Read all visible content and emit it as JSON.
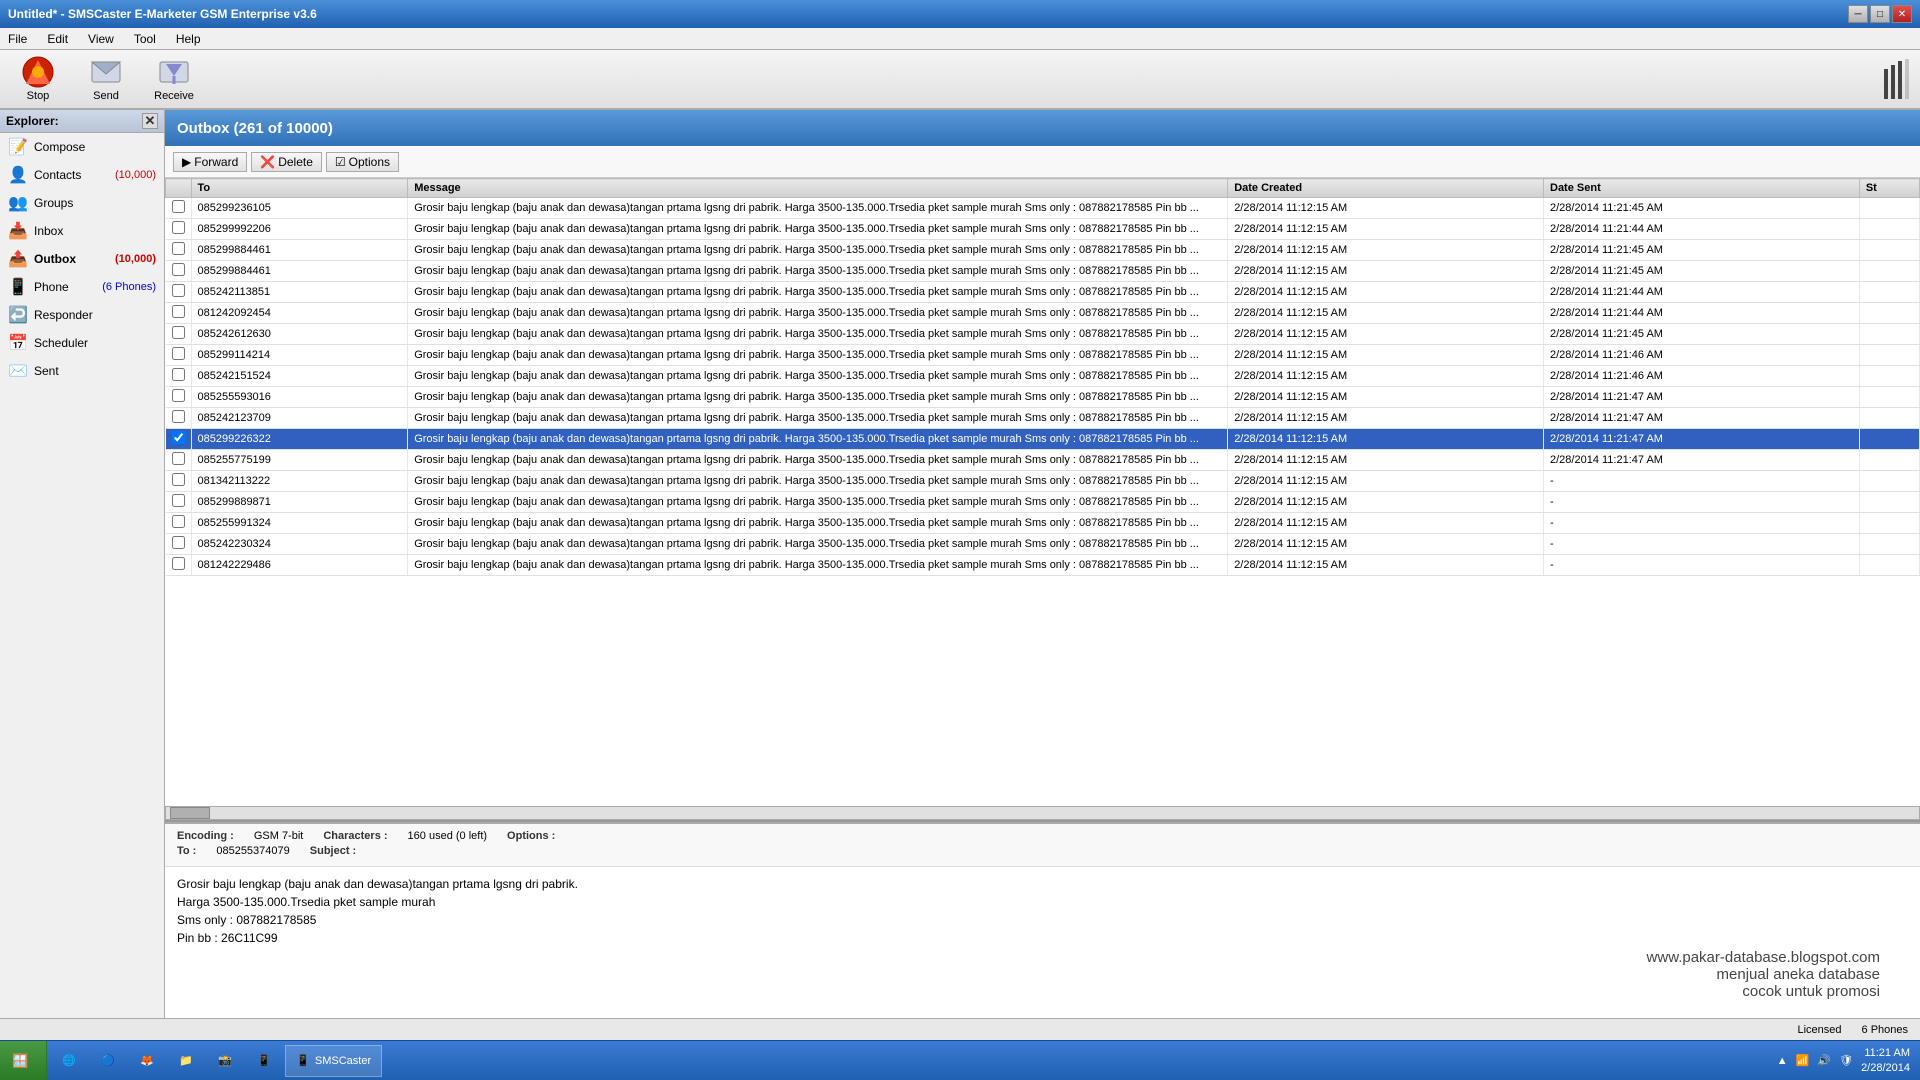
{
  "window": {
    "title": "Untitled* - SMSCaster E-Marketer GSM Enterprise v3.6",
    "controls": [
      "minimize",
      "maximize",
      "close"
    ]
  },
  "menu": {
    "items": [
      "File",
      "Edit",
      "View",
      "Tool",
      "Help"
    ]
  },
  "toolbar": {
    "stop_label": "Stop",
    "send_label": "Send",
    "receive_label": "Receive"
  },
  "explorer": {
    "title": "Explorer:",
    "items": [
      {
        "id": "compose",
        "label": "Compose",
        "badge": ""
      },
      {
        "id": "contacts",
        "label": "Contacts",
        "badge": "(10,000)"
      },
      {
        "id": "groups",
        "label": "Groups",
        "badge": ""
      },
      {
        "id": "inbox",
        "label": "Inbox",
        "badge": ""
      },
      {
        "id": "outbox",
        "label": "Outbox",
        "badge": "(10,000)"
      },
      {
        "id": "phone",
        "label": "Phone",
        "badge": "(6 Phones)"
      },
      {
        "id": "responder",
        "label": "Responder",
        "badge": ""
      },
      {
        "id": "scheduler",
        "label": "Scheduler",
        "badge": ""
      },
      {
        "id": "sent",
        "label": "Sent",
        "badge": ""
      }
    ]
  },
  "outbox": {
    "title": "Outbox (261 of 10000)"
  },
  "actions": {
    "forward": "Forward",
    "delete": "Delete",
    "options": "Options"
  },
  "table": {
    "columns": [
      "",
      "To",
      "Message",
      "Date Created",
      "Date Sent",
      "St"
    ],
    "rows": [
      {
        "to": "085299236105",
        "message": "Grosir baju lengkap (baju anak dan dewasa)tangan prtama lgsng dri pabrik. Harga 3500-135.000.Trsedia pket sample murah Sms only : 087882178585 Pin bb ...",
        "date_created": "2/28/2014 11:12:15 AM",
        "date_sent": "2/28/2014 11:21:45 AM",
        "selected": false
      },
      {
        "to": "085299992206",
        "message": "Grosir baju lengkap (baju anak dan dewasa)tangan prtama lgsng dri pabrik. Harga 3500-135.000.Trsedia pket sample murah Sms only : 087882178585 Pin bb ...",
        "date_created": "2/28/2014 11:12:15 AM",
        "date_sent": "2/28/2014 11:21:44 AM",
        "selected": false
      },
      {
        "to": "085299884461",
        "message": "Grosir baju lengkap (baju anak dan dewasa)tangan prtama lgsng dri pabrik. Harga 3500-135.000.Trsedia pket sample murah Sms only : 087882178585 Pin bb ...",
        "date_created": "2/28/2014 11:12:15 AM",
        "date_sent": "2/28/2014 11:21:45 AM",
        "selected": false
      },
      {
        "to": "085299884461",
        "message": "Grosir baju lengkap (baju anak dan dewasa)tangan prtama lgsng dri pabrik. Harga 3500-135.000.Trsedia pket sample murah Sms only : 087882178585 Pin bb ...",
        "date_created": "2/28/2014 11:12:15 AM",
        "date_sent": "2/28/2014 11:21:45 AM",
        "selected": false
      },
      {
        "to": "085242113851",
        "message": "Grosir baju lengkap (baju anak dan dewasa)tangan prtama lgsng dri pabrik. Harga 3500-135.000.Trsedia pket sample murah Sms only : 087882178585 Pin bb ...",
        "date_created": "2/28/2014 11:12:15 AM",
        "date_sent": "2/28/2014 11:21:44 AM",
        "selected": false
      },
      {
        "to": "081242092454",
        "message": "Grosir baju lengkap (baju anak dan dewasa)tangan prtama lgsng dri pabrik. Harga 3500-135.000.Trsedia pket sample murah Sms only : 087882178585 Pin bb ...",
        "date_created": "2/28/2014 11:12:15 AM",
        "date_sent": "2/28/2014 11:21:44 AM",
        "selected": false
      },
      {
        "to": "085242612630",
        "message": "Grosir baju lengkap (baju anak dan dewasa)tangan prtama lgsng dri pabrik. Harga 3500-135.000.Trsedia pket sample murah Sms only : 087882178585 Pin bb ...",
        "date_created": "2/28/2014 11:12:15 AM",
        "date_sent": "2/28/2014 11:21:45 AM",
        "selected": false
      },
      {
        "to": "085299114214",
        "message": "Grosir baju lengkap (baju anak dan dewasa)tangan prtama lgsng dri pabrik. Harga 3500-135.000.Trsedia pket sample murah Sms only : 087882178585 Pin bb ...",
        "date_created": "2/28/2014 11:12:15 AM",
        "date_sent": "2/28/2014 11:21:46 AM",
        "selected": false
      },
      {
        "to": "085242151524",
        "message": "Grosir baju lengkap (baju anak dan dewasa)tangan prtama lgsng dri pabrik. Harga 3500-135.000.Trsedia pket sample murah Sms only : 087882178585 Pin bb ...",
        "date_created": "2/28/2014 11:12:15 AM",
        "date_sent": "2/28/2014 11:21:46 AM",
        "selected": false
      },
      {
        "to": "085255593016",
        "message": "Grosir baju lengkap (baju anak dan dewasa)tangan prtama lgsng dri pabrik. Harga 3500-135.000.Trsedia pket sample murah Sms only : 087882178585 Pin bb ...",
        "date_created": "2/28/2014 11:12:15 AM",
        "date_sent": "2/28/2014 11:21:47 AM",
        "selected": false
      },
      {
        "to": "085242123709",
        "message": "Grosir baju lengkap (baju anak dan dewasa)tangan prtama lgsng dri pabrik. Harga 3500-135.000.Trsedia pket sample murah Sms only : 087882178585 Pin bb ...",
        "date_created": "2/28/2014 11:12:15 AM",
        "date_sent": "2/28/2014 11:21:47 AM",
        "selected": false
      },
      {
        "to": "085299226322",
        "message": "Grosir baju lengkap (baju anak dan dewasa)tangan prtama lgsng dri pabrik. Harga 3500-135.000.Trsedia pket sample murah Sms only : 087882178585 Pin bb ...",
        "date_created": "2/28/2014 11:12:15 AM",
        "date_sent": "2/28/2014 11:21:47 AM",
        "selected": true
      },
      {
        "to": "085255775199",
        "message": "Grosir baju lengkap (baju anak dan dewasa)tangan prtama lgsng dri pabrik. Harga 3500-135.000.Trsedia pket sample murah Sms only : 087882178585 Pin bb ...",
        "date_created": "2/28/2014 11:12:15 AM",
        "date_sent": "2/28/2014 11:21:47 AM",
        "selected": false
      },
      {
        "to": "081342113222",
        "message": "Grosir baju lengkap (baju anak dan dewasa)tangan prtama lgsng dri pabrik. Harga 3500-135.000.Trsedia pket sample murah Sms only : 087882178585 Pin bb ...",
        "date_created": "2/28/2014 11:12:15 AM",
        "date_sent": "-",
        "selected": false
      },
      {
        "to": "085299889871",
        "message": "Grosir baju lengkap (baju anak dan dewasa)tangan prtama lgsng dri pabrik. Harga 3500-135.000.Trsedia pket sample murah Sms only : 087882178585 Pin bb ...",
        "date_created": "2/28/2014 11:12:15 AM",
        "date_sent": "-",
        "selected": false
      },
      {
        "to": "085255991324",
        "message": "Grosir baju lengkap (baju anak dan dewasa)tangan prtama lgsng dri pabrik. Harga 3500-135.000.Trsedia pket sample murah Sms only : 087882178585 Pin bb ...",
        "date_created": "2/28/2014 11:12:15 AM",
        "date_sent": "-",
        "selected": false
      },
      {
        "to": "085242230324",
        "message": "Grosir baju lengkap (baju anak dan dewasa)tangan prtama lgsng dri pabrik. Harga 3500-135.000.Trsedia pket sample murah Sms only : 087882178585 Pin bb ...",
        "date_created": "2/28/2014 11:12:15 AM",
        "date_sent": "-",
        "selected": false
      },
      {
        "to": "081242229486",
        "message": "Grosir baju lengkap (baju anak dan dewasa)tangan prtama lgsng dri pabrik. Harga 3500-135.000.Trsedia pket sample murah Sms only : 087882178585 Pin bb ...",
        "date_created": "2/28/2014 11:12:15 AM",
        "date_sent": "-",
        "selected": false
      }
    ]
  },
  "info_panel": {
    "encoding_label": "Encoding :",
    "encoding_value": "GSM 7-bit",
    "characters_label": "Characters :",
    "characters_value": "160 used (0 left)",
    "options_label": "Options :",
    "to_label": "To :",
    "to_value": "085255374079",
    "subject_label": "Subject :"
  },
  "message_body": {
    "line1": "Grosir baju lengkap (baju anak dan dewasa)tangan prtama lgsng dri pabrik.",
    "line2": "Harga 3500-135.000.Trsedia pket sample murah",
    "line3": "Sms only : 087882178585",
    "line4": "Pin bb : 26C11C99"
  },
  "watermark": {
    "line1": "www.pakar-database.blogspot.com",
    "line2": "menjual aneka database",
    "line3": "cocok untuk promosi"
  },
  "statusbar": {
    "licensed": "Licensed",
    "phones": "6 Phones"
  },
  "taskbar": {
    "apps": [
      "🪟",
      "🌐",
      "🔵",
      "🦊",
      "📁",
      "📸",
      "📱"
    ],
    "time": "11:21 AM",
    "date": "2/28/2014"
  }
}
